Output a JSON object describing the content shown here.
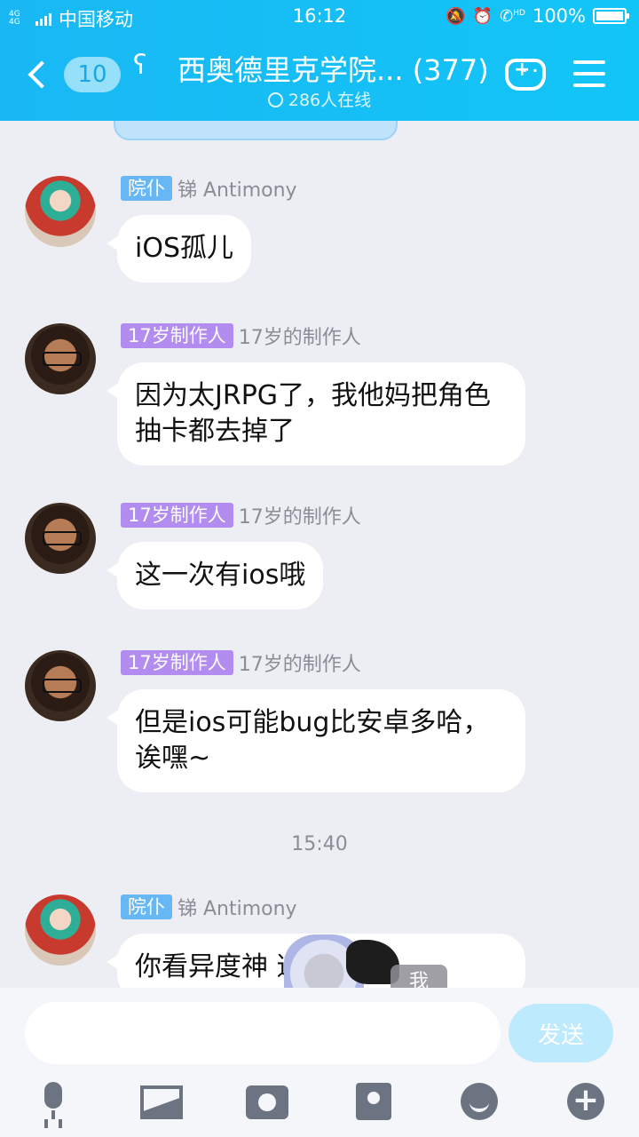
{
  "status_bar": {
    "network": "4G 4G",
    "carrier": "中国移动",
    "time": "16:12",
    "hd": "HD",
    "battery_text": "100%",
    "battery_level": 1.0
  },
  "header": {
    "unread_count": "10",
    "group_title": "西奥德里克学院... (377)",
    "online_text": "286人在线",
    "accent_color": "#19b8f4"
  },
  "messages": [
    {
      "tag": "院仆",
      "tag_color": "blue",
      "sender": "锑 Antimony",
      "avatar": "anime-avatar",
      "text": "iOS孤儿"
    },
    {
      "tag": "17岁制作人",
      "tag_color": "purple",
      "sender": "17岁的制作人",
      "avatar": "photo-avatar",
      "text": "因为太JRPG了，我他妈把角色抽卡都去掉了"
    },
    {
      "tag": "17岁制作人",
      "tag_color": "purple",
      "sender": "17岁的制作人",
      "avatar": "photo-avatar",
      "text": "这一次有ios哦"
    },
    {
      "tag": "17岁制作人",
      "tag_color": "purple",
      "sender": "17岁的制作人",
      "avatar": "photo-avatar",
      "text": "但是ios可能bug比安卓多哈，诶嘿~"
    },
    {
      "tag": "院仆",
      "tag_color": "blue",
      "sender": "锑 Antimony",
      "avatar": "anime-avatar",
      "text": "你看异度神 道"
    }
  ],
  "time_separator": "15:40",
  "sticker_label": "我",
  "input": {
    "placeholder": "",
    "send_label": "发送"
  },
  "toolbar": [
    "mic-icon",
    "image-icon",
    "camera-icon",
    "red-packet-icon",
    "emoji-icon",
    "plus-icon"
  ]
}
